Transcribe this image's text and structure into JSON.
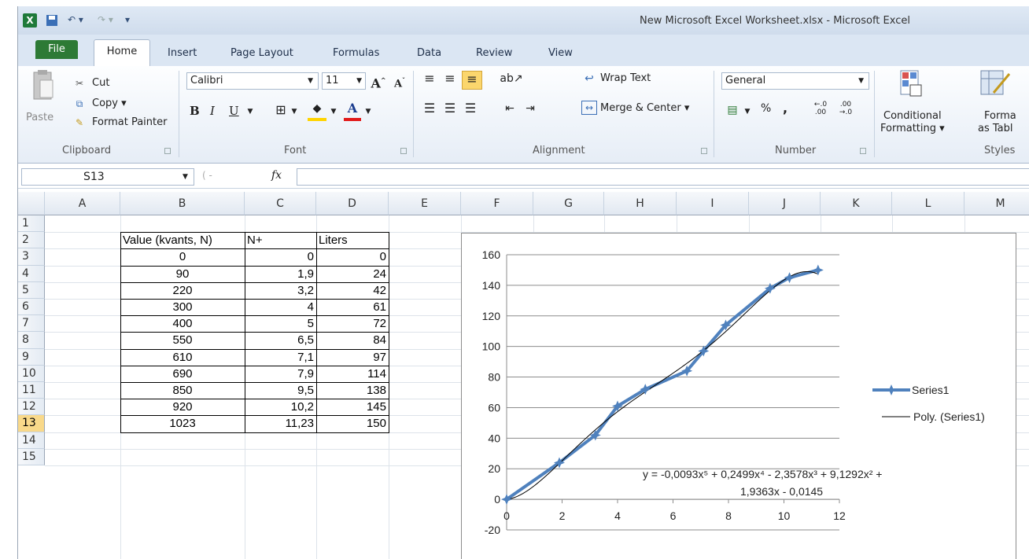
{
  "window": {
    "title": "New Microsoft Excel Worksheet.xlsx - Microsoft Excel"
  },
  "tabs": {
    "file": "File",
    "home": "Home",
    "insert": "Insert",
    "page_layout": "Page Layout",
    "formulas": "Formulas",
    "data": "Data",
    "review": "Review",
    "view": "View"
  },
  "ribbon": {
    "clipboard": {
      "paste": "Paste",
      "cut": "Cut",
      "copy": "Copy ▾",
      "format_painter": "Format Painter",
      "label": "Clipboard"
    },
    "font": {
      "name": "Calibri",
      "size": "11",
      "bold": "B",
      "italic": "I",
      "underline": "U",
      "label": "Font"
    },
    "alignment": {
      "wrap_text": "Wrap Text",
      "merge_center": "Merge & Center ▾",
      "label": "Alignment"
    },
    "number": {
      "format": "General",
      "percent": "%",
      "comma": ",",
      "label": "Number"
    },
    "styles": {
      "conditional": "Conditional",
      "conditional2": "Formatting ▾",
      "format_table": "Forma",
      "format_table2": "as Tabl",
      "label": "Styles"
    }
  },
  "formula_bar": {
    "name_box": "S13",
    "fx": "fx",
    "formula": ""
  },
  "sheet": {
    "columns": [
      "A",
      "B",
      "C",
      "D",
      "E",
      "F",
      "G",
      "H",
      "I",
      "J",
      "K",
      "L",
      "M"
    ],
    "rows": [
      "1",
      "2",
      "3",
      "4",
      "5",
      "6",
      "7",
      "8",
      "9",
      "10",
      "11",
      "12",
      "13",
      "14",
      "15"
    ],
    "selected_row": "13",
    "headers": {
      "b": "Value (kvants, N)",
      "c": "N+",
      "d": "Liters"
    },
    "table": [
      [
        "0",
        "0",
        "0"
      ],
      [
        "90",
        "1,9",
        "24"
      ],
      [
        "220",
        "3,2",
        "42"
      ],
      [
        "300",
        "4",
        "61"
      ],
      [
        "400",
        "5",
        "72"
      ],
      [
        "550",
        "6,5",
        "84"
      ],
      [
        "610",
        "7,1",
        "97"
      ],
      [
        "690",
        "7,9",
        "114"
      ],
      [
        "850",
        "9,5",
        "138"
      ],
      [
        "920",
        "10,2",
        "145"
      ],
      [
        "1023",
        "11,23",
        "150"
      ]
    ]
  },
  "chart_data": {
    "type": "scatter",
    "x": [
      0,
      1.9,
      3.2,
      4,
      5,
      6.5,
      7.1,
      7.9,
      9.5,
      10.2,
      11.23
    ],
    "series": [
      {
        "name": "Series1",
        "y": [
          0,
          24,
          42,
          61,
          72,
          84,
          97,
          114,
          138,
          145,
          150
        ],
        "color": "#4f81bd"
      },
      {
        "name": "Poly. (Series1)",
        "type": "trendline",
        "color": "#000000"
      }
    ],
    "trendline_coeffs": [
      -0.0093,
      0.2499,
      -2.3578,
      9.1292,
      1.9363,
      -0.0145
    ],
    "equation_line1": "y = -0,0093x⁵ + 0,2499x⁴ - 2,3578x³ + 9,1292x² +",
    "equation_line2": "1,9363x - 0,0145",
    "xlim": [
      0,
      12
    ],
    "ylim": [
      -20,
      160
    ],
    "xticks": [
      "0",
      "2",
      "4",
      "6",
      "8",
      "10",
      "12"
    ],
    "yticks": [
      "160",
      "140",
      "120",
      "100",
      "80",
      "60",
      "40",
      "20",
      "0",
      "-20"
    ],
    "grid": true,
    "legend": "right"
  }
}
